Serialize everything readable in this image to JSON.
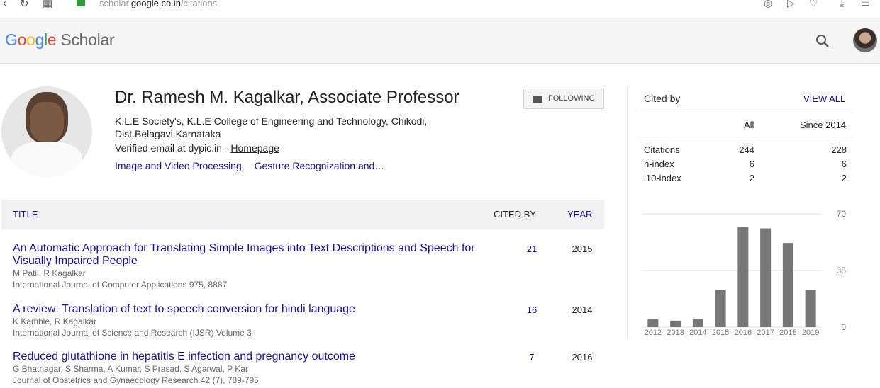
{
  "browser": {
    "url_prefix": "scholar.",
    "url_domain": "google.co.in",
    "url_path": "/citations"
  },
  "header": {
    "logo_letters": [
      "G",
      "o",
      "o",
      "g",
      "l",
      "e"
    ],
    "logo_suffix": "Scholar"
  },
  "profile": {
    "name": "Dr. Ramesh M. Kagalkar, Associate Professor",
    "affiliation": "K.L.E Society's, K.L.E College of Engineering and Technology, Chikodi, Dist.Belagavi,Karnataka",
    "email": "Verified email at dypic.in - ",
    "homepage": "Homepage",
    "interests": [
      "Image and Video Processing",
      "Gesture Recognization and…"
    ],
    "follow_label": "FOLLOWING"
  },
  "table": {
    "headers": {
      "title": "TITLE",
      "cited_by": "CITED BY",
      "year": "YEAR"
    },
    "rows": [
      {
        "title": "An Automatic Approach for Translating Simple Images into Text Descriptions and Speech for Visually Impaired People",
        "authors": "M Patil, R Kagalkar",
        "journal": "International Journal of Computer Applications 975, 8887",
        "cited": "21",
        "year": "2015"
      },
      {
        "title": "A review: Translation of text to speech conversion for hindi language",
        "authors": "K Kamble, R Kagalkar",
        "journal": "International Journal of Science and Research (IJSR) Volume 3",
        "cited": "16",
        "year": "2014"
      },
      {
        "title": "Reduced glutathione in hepatitis E infection and pregnancy outcome",
        "authors": "G Bhatnagar, S Sharma, A Kumar, S Prasad, S Agarwal, P Kar",
        "journal": "Journal of Obstetrics and Gynaecology Research 42 (7), 789-795",
        "cited": "7",
        "year": "2016"
      }
    ]
  },
  "cited_by": {
    "title": "Cited by",
    "view_all": "VIEW ALL",
    "col_all": "All",
    "col_since": "Since 2014",
    "stats": [
      {
        "label": "Citations",
        "all": "244",
        "since": "228"
      },
      {
        "label": "h-index",
        "all": "6",
        "since": "6"
      },
      {
        "label": "i10-index",
        "all": "2",
        "since": "2"
      }
    ]
  },
  "chart_data": {
    "type": "bar",
    "categories": [
      "2012",
      "2013",
      "2014",
      "2015",
      "2016",
      "2017",
      "2018",
      "2019"
    ],
    "values": [
      5,
      4,
      5,
      23,
      62,
      61,
      52,
      23
    ],
    "ylim": [
      0,
      70
    ],
    "yticks": [
      "70",
      "35",
      "0"
    ],
    "bar_color": "#777777",
    "grid": true
  }
}
